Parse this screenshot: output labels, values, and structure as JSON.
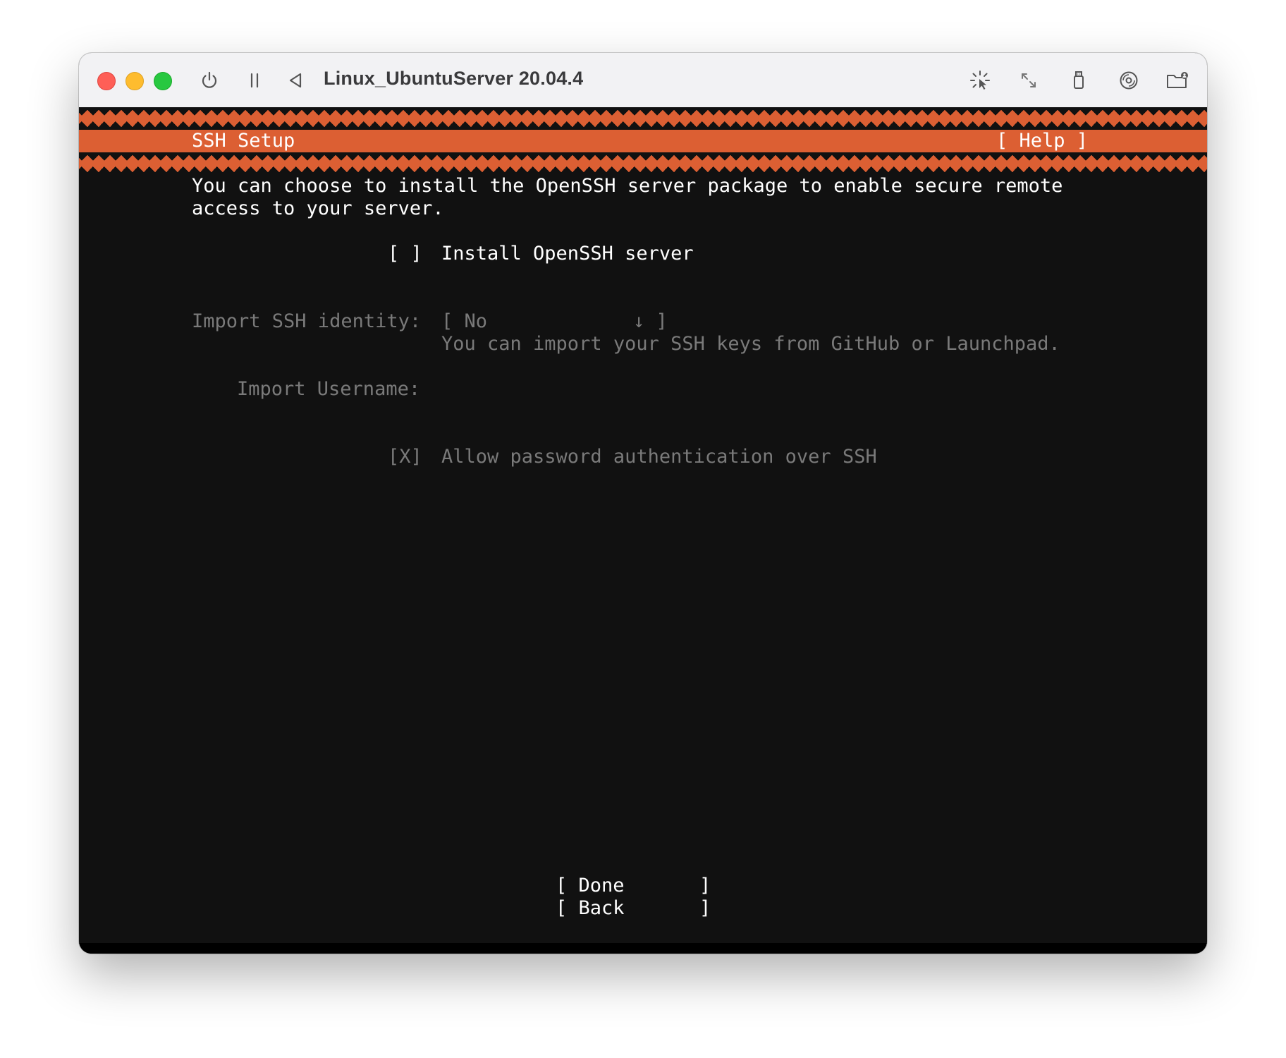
{
  "window": {
    "title": "Linux_UbuntuServer 20.04.4"
  },
  "toolbar_icons": [
    "power-icon",
    "pause-icon",
    "back-triangle-icon",
    "capture-input-icon",
    "resize-icon",
    "usb-icon",
    "disc-icon",
    "shared-folder-icon"
  ],
  "installer": {
    "header_title": "SSH Setup",
    "help_button": "[ Help ]",
    "description_line1": "You can choose to install the OpenSSH server package to enable secure remote",
    "description_line2": "access to your server.",
    "install_checkbox": "[ ]",
    "install_label": "Install OpenSSH server",
    "import_identity_label": "Import SSH identity:",
    "import_identity_select_open": "[ No",
    "import_identity_select_arrow": "↓ ]",
    "import_identity_hint": "You can import your SSH keys from GitHub or Launchpad.",
    "import_username_label": "Import Username:",
    "import_username_value": "",
    "password_checkbox": "[X]",
    "password_label": "Allow password authentication over SSH",
    "done_button_left": "[ Done",
    "done_button_right": "]",
    "back_button_left": "[ Back",
    "back_button_right": "]"
  },
  "colors": {
    "accent": "#dc5f33",
    "terminal_bg": "#111111",
    "text": "#ffffff",
    "disabled_text": "#7a7a7a"
  }
}
